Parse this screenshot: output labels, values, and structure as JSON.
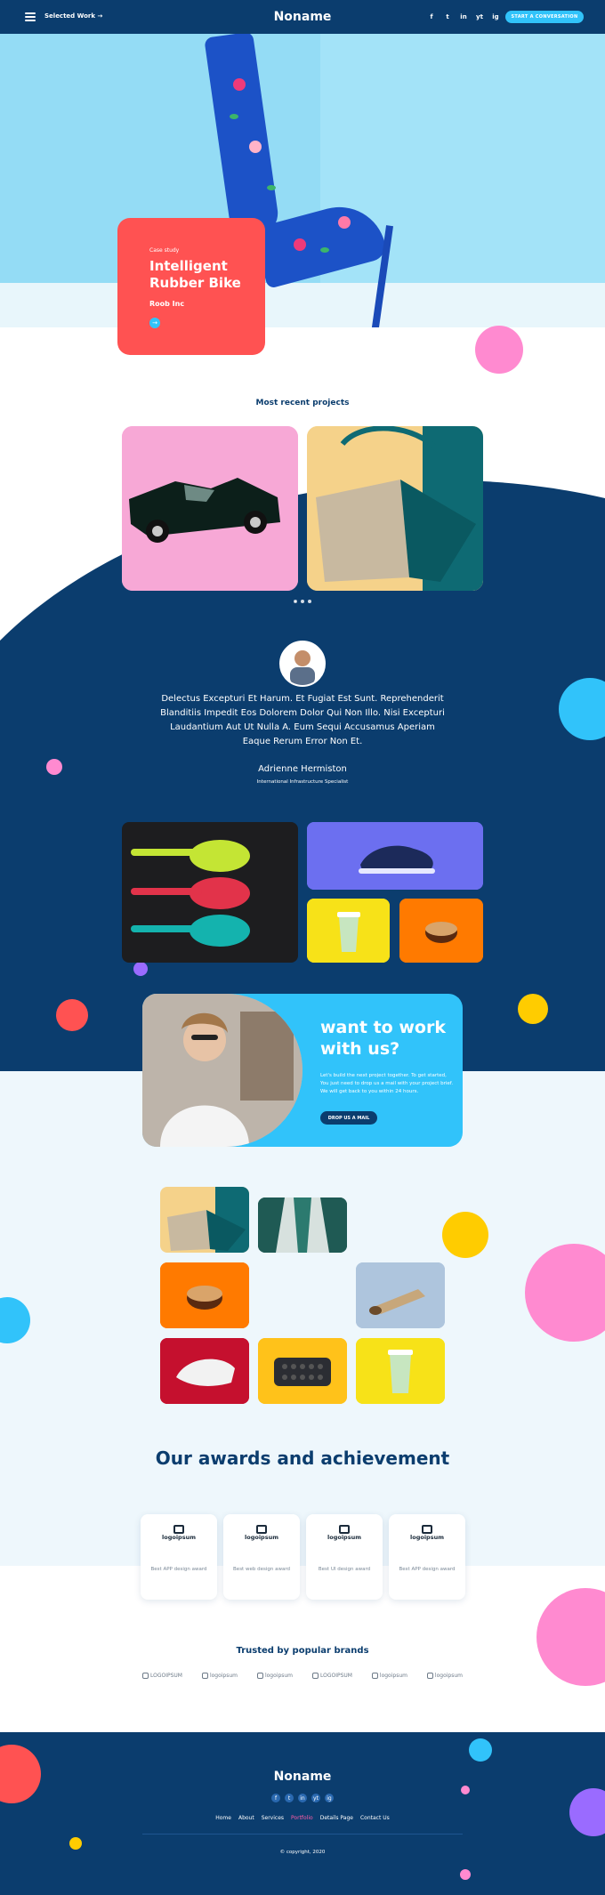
{
  "header": {
    "nav_label": "Selected Work",
    "nav_arrow": "→",
    "brand": "Noname",
    "socials": [
      "f",
      "t",
      "in",
      "yt",
      "ig"
    ],
    "cta": "START A CONVERSATION"
  },
  "hero": {
    "case_label": "Case study",
    "case_title": "Intelligent Rubber Bike",
    "case_client": "Roob Inc",
    "case_button_icon": "→"
  },
  "projects": {
    "title": "Most recent projects",
    "items": [
      "toy-car",
      "handbag"
    ]
  },
  "testimonial": {
    "quote": "Delectus Excepturi Et Harum. Et Fugiat Est Sunt. Reprehenderit Blanditiis Impedit Eos Dolorem Dolor Qui Non Illo. Nisi Excepturi Laudantium Aut Ut Nulla A. Eum Sequi Accusamus Aperiam Eaque Rerum Error Non Et.",
    "name": "Adrienne Hermiston",
    "role": "International Infrastructure Specialist"
  },
  "work": {
    "title": "want to work with us?",
    "text": "Let's build the next project together. To get started, You just need to drop us a mail with your project brief. We will get back to you within 24 hours.",
    "button": "DROP US A MAIL"
  },
  "awards": {
    "title": "Our awards and achievement",
    "items": [
      {
        "logo": "logoipsum",
        "text": "Best APP design award"
      },
      {
        "logo": "logoipsum",
        "text": "Best web design award"
      },
      {
        "logo": "logoipsum",
        "text": "Best UI design award"
      },
      {
        "logo": "logoipsum",
        "text": "Best APP design award"
      }
    ]
  },
  "brands": {
    "title": "Trusted by popular brands",
    "items": [
      "LOGOIPSUM",
      "logoipsum",
      "logoipsum",
      "LOGOIPSUM",
      "logoipsum",
      "logoipsum"
    ]
  },
  "footer": {
    "brand": "Noname",
    "socials": [
      "f",
      "t",
      "in",
      "yt",
      "ig"
    ],
    "nav": [
      "Home",
      "About",
      "Services",
      "Portfolio",
      "Details Page",
      "Contact Us"
    ],
    "active_nav": "Portfolio",
    "copyright": "© copyright, 2020"
  },
  "colors": {
    "navy": "#0b3d6e",
    "coral": "#ff5252",
    "sky": "#31c3fa",
    "pink": "#ff8ad0",
    "yellow": "#ffcc00",
    "purple": "#9a6bff"
  }
}
